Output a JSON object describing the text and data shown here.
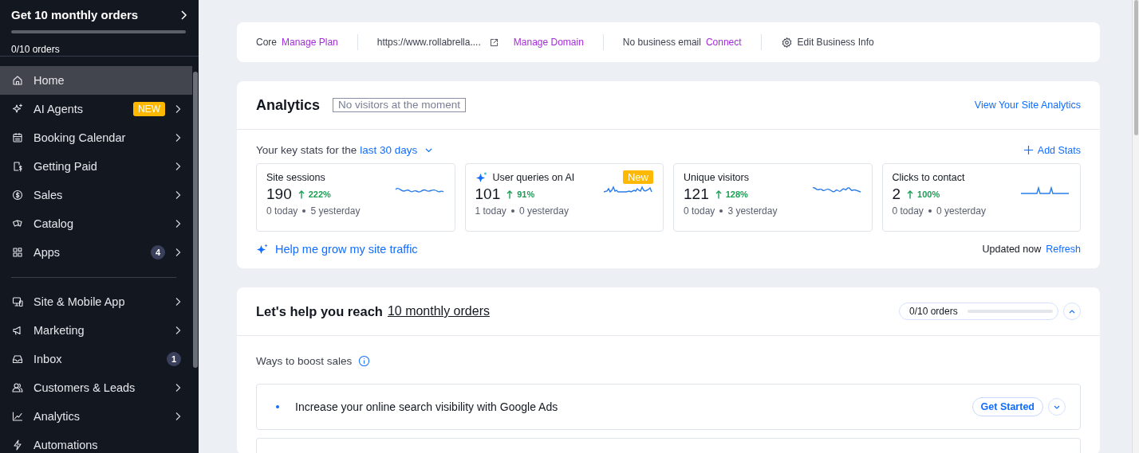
{
  "sidebar": {
    "goal": {
      "title": "Get 10 monthly orders",
      "level": 0,
      "progress_text": "0/10 orders"
    },
    "groups": [
      [
        {
          "label": "Home",
          "selected": true,
          "chevron": false
        },
        {
          "label": "AI Agents",
          "selected": false,
          "chevron": true,
          "tag": "NEW"
        },
        {
          "label": "Booking Calendar",
          "selected": false,
          "chevron": true
        },
        {
          "label": "Getting Paid",
          "selected": false,
          "chevron": true
        },
        {
          "label": "Sales",
          "selected": false,
          "chevron": true
        },
        {
          "label": "Catalog",
          "selected": false,
          "chevron": true
        },
        {
          "label": "Apps",
          "selected": false,
          "chevron": true,
          "count": "4"
        }
      ],
      [
        {
          "label": "Site & Mobile App",
          "selected": false,
          "chevron": true
        },
        {
          "label": "Marketing",
          "selected": false,
          "chevron": true
        },
        {
          "label": "Inbox",
          "selected": false,
          "chevron": false,
          "count": "1"
        },
        {
          "label": "Customers & Leads",
          "selected": false,
          "chevron": true
        },
        {
          "label": "Analytics",
          "selected": false,
          "chevron": true
        },
        {
          "label": "Automations",
          "selected": false,
          "chevron": false
        }
      ]
    ]
  },
  "info_bar": {
    "plan": "Core",
    "plan_link": "Manage Plan",
    "domain": "https://www.rollabrella....",
    "domain_link": "Manage Domain",
    "email": "No business email",
    "email_link": "Connect",
    "edit": "Edit Business Info"
  },
  "analytics": {
    "title": "Analytics",
    "status": "No visitors at the moment",
    "view_link": "View Your Site Analytics",
    "period_prefix": "Your key stats for the",
    "period": "last 30 days",
    "add": "Add Stats",
    "stats": [
      {
        "title": "Site sessions",
        "value": "190",
        "change": "222%",
        "today": "0 today",
        "yesterday": "5 yesterday",
        "sparkle": false
      },
      {
        "title": "User queries on AI",
        "value": "101",
        "change": "91%",
        "today": "1 today",
        "yesterday": "0 yesterday",
        "sparkle": true,
        "tag": "New"
      },
      {
        "title": "Unique visitors",
        "value": "121",
        "change": "128%",
        "today": "0 today",
        "yesterday": "3 yesterday",
        "sparkle": false
      },
      {
        "title": "Clicks to contact",
        "value": "2",
        "change": "100%",
        "today": "0 today",
        "yesterday": "0 yesterday",
        "sparkle": false
      }
    ],
    "help": "Help me grow my site traffic",
    "updated": "Updated now",
    "refresh": "Refresh"
  },
  "goal_card": {
    "title": "Let's help you reach",
    "goal_link": "10 monthly orders",
    "progress_text": "0/10 orders",
    "level": 0,
    "expanded": true,
    "section": "Ways to boost sales",
    "tasks": [
      {
        "text": "Increase your online search visibility with Google Ads",
        "button": "Get Started",
        "expanded": false
      }
    ]
  }
}
